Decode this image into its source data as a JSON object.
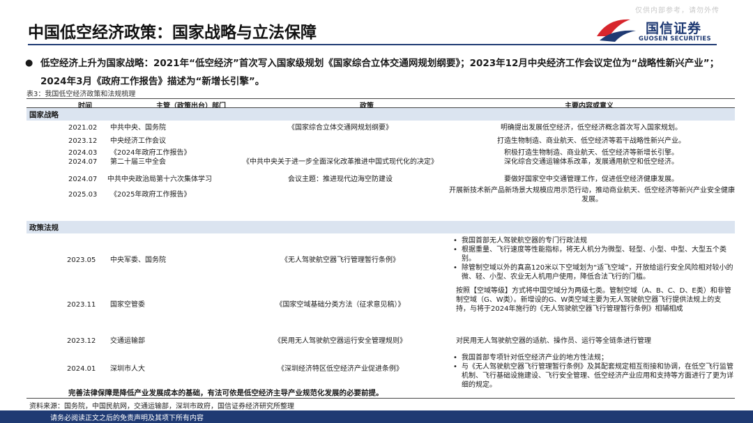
{
  "watermark": "仅供内部参考，请勿外传",
  "title": "中国低空经济政策：国家战略与立法保障",
  "logo": {
    "cn": "国信证券",
    "en": "GUOSEN SECURITIES",
    "colors": {
      "red": "#d7252c",
      "blue": "#1f3a73"
    }
  },
  "bullet": {
    "line1": "低空经济上升为国家战略：2021年“低空经济”首次写入国家级规划《国家综合立体交通网规划纲要》；2023年12月中央经济工作会议定位为“战略性新兴产业”；",
    "line2": "2024年3月《政府工作报告》描述为“新增长引擎”。"
  },
  "table_caption": "表3：我国低空经济政策和法规梳理",
  "table": {
    "headers": {
      "time": "时间",
      "dept": "主管（政策出台）部门",
      "policy": "政策",
      "content": "主要内容或意义"
    },
    "section1": "国家战略",
    "section2": "政策法规",
    "rows": [
      {
        "time": "2021.02",
        "dept": "中共中央、国务院",
        "policy": "《国家综合立体交通网规划纲要》",
        "content": "明确提出发展低空经济，低空经济概念首次写入国家规划。"
      },
      {
        "time": "2023.12",
        "dept": "中央经济工作会议",
        "policy": "",
        "content": "打造生物制造、商业航天、低空经济等若干战略性新兴产业。"
      },
      {
        "time": "2024.03",
        "dept": "《2024年政府工作报告》",
        "policy": "",
        "content": "积极打造生物制造、商业航天、低空经济等新增长引擎。"
      },
      {
        "time": "2024.07",
        "dept": "第二十届三中全会",
        "policy": "《中共中央关于进一步全面深化改革推进中国式现代化的决定》",
        "content": "深化综合交通运输体系改革，发展通用航空和低空经济。"
      },
      {
        "time": "2024.07",
        "dept": "中共中央政治局第十六次集体学习",
        "policy": "会议主题：推进现代边海空防建设",
        "content": "要做好国家空中交通管理工作，促进低空经济健康发展。"
      },
      {
        "time": "2025.03",
        "dept": "《2025年政府工作报告》",
        "policy": "",
        "content": "开展新技术新产品新场景大规模应用示范行动，推动商业航天、低空经济等新兴产业安全健康发展。"
      },
      {
        "time": "2023.05",
        "dept": "中央军委、国务院",
        "policy": "《无人驾驶航空器飞行管理暂行条例》",
        "items": [
          "我国首部无人驾驶航空器的专门行政法规",
          "根据重量、飞行速度等性能指标，将无人机分为微型、轻型、小型、中型、大型五个类别。",
          "除管制空域以外的真高120米以下空域划为“适飞空域”，开放给运行安全风险相对较小的微、轻、小型、农业无人机用户使用，降低合法飞行的门槛。"
        ]
      },
      {
        "time": "2023.11",
        "dept": "国家空管委",
        "policy": "《国家空域基础分类方法（征求意见稿）》",
        "content": "按照【空域等级】方式将中国空域分为两级七类。管制空域（A、B、C、D、E类）和非管制空域（G、W类）。新增设的G、W类空域主要为无人驾驶航空器飞行提供法规上的支持，与将于2024年施行的《无人驾驶航空器飞行管理暂行条例》相辅相成"
      },
      {
        "time": "2023.12",
        "dept": "交通运输部",
        "policy": "《民用无人驾驶航空器运行安全管理规则》",
        "content": "对民用无人驾驶航空器的适航、操作员、运行等全链条进行管理"
      },
      {
        "time": "2024.01",
        "dept": "深圳市人大",
        "policy": "《深圳经济特区低空经济产业促进条例》",
        "items": [
          "我国首部专项针对低空经济产业的地方性法规；",
          "与《无人驾驶航空器飞行管理暂行条例》及其配套规定相互衔接和协调，在低空飞行监管机制、飞行基础设施建设、飞行安全管理、低空经济产业应用和支持等方面进行了更为详细的规定。"
        ]
      }
    ]
  },
  "conclusion": "完善法律保障是降低产业发展成本的基础，有法可依是低空经济主导产业规范化发展的必要前提。",
  "source": "资料来源：国务院，中国民航网，交通运输部，深圳市政府，国信证券经济研究所整理",
  "footer": "请务必阅读正文之后的免责声明及其项下所有内容"
}
